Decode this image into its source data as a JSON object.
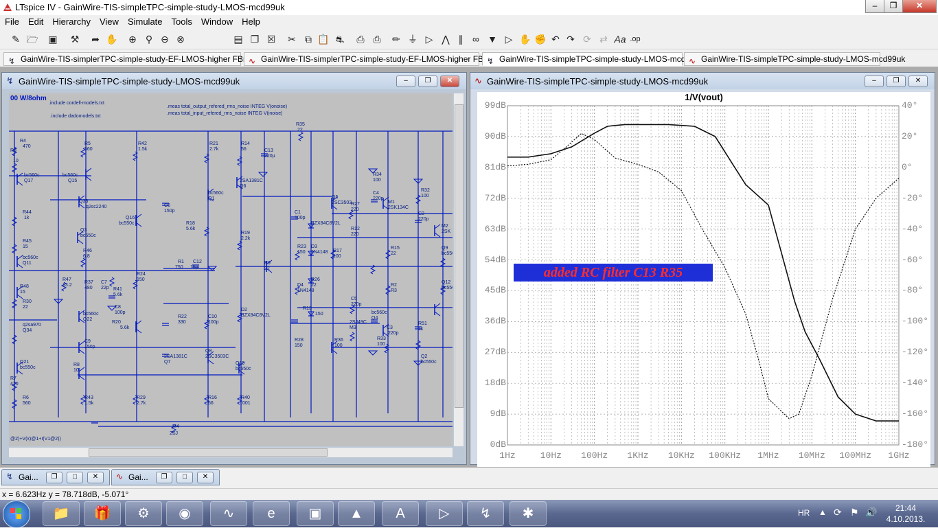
{
  "app": {
    "title": "LTspice IV - GainWire-TIS-simpleTPC-simple-study-LMOS-mcd99uk"
  },
  "menu": [
    "File",
    "Edit",
    "Hierarchy",
    "View",
    "Simulate",
    "Tools",
    "Window",
    "Help"
  ],
  "toolbar_icons": [
    "new-schematic-icon",
    "open-icon",
    "save-icon",
    "control-panel-icon",
    "run-icon",
    "halt-icon",
    "zoom-in-icon",
    "pan-icon",
    "zoom-out-icon",
    "zoom-fit-icon",
    "tile-horizontal-icon",
    "cascade-icon",
    "close-all-icon",
    "cut-icon",
    "copy-icon",
    "paste-icon",
    "find-icon",
    "print-setup-icon",
    "print-icon",
    "wire-icon",
    "ground-icon",
    "label-icon",
    "resistor-icon",
    "capacitor-icon",
    "inductor-icon",
    "diode-icon",
    "component-icon",
    "move-icon",
    "drag-icon",
    "undo-icon",
    "redo-icon",
    "rotate-icon",
    "mirror-icon",
    "text-icon",
    "spice-directive-icon"
  ],
  "tabs": [
    {
      "label": "GainWire-TIS-simplerTPC-simple-study-EF-LMOS-higher FBresistors",
      "kind": "schematic"
    },
    {
      "label": "GainWire-TIS-simplerTPC-simple-study-EF-LMOS-higher FBresistors",
      "kind": "waveform"
    },
    {
      "label": "GainWire-TIS-simpleTPC-simple-study-LMOS-mcd99uk",
      "kind": "schematic",
      "active": true
    },
    {
      "label": "GainWire-TIS-simpleTPC-simple-study-LMOS-mcd99uk",
      "kind": "waveform"
    }
  ],
  "schematic_window": {
    "title": "GainWire-TIS-simpleTPC-simple-study-LMOS-mcd99uk",
    "heading": "00 W/8ohm",
    "directives": [
      ".include cordell-models.txt",
      ".include dadomodels.txt",
      ".meas total_output_refered_rms_noise INTEG V(onoise)",
      ".meas total_input_refered_rms_noise INTEG V(inoise)"
    ],
    "labels": [
      "R4",
      "470",
      "R3",
      "10",
      "R5",
      "560",
      "R42",
      "1.5k",
      "R21",
      "2.7k",
      "R14",
      "56",
      "C13",
      "220µ",
      "R35",
      "22",
      "bc560c",
      "Q17",
      "bc560c",
      "Q15",
      "Q33",
      "q2sc2240",
      "bc560c",
      "Q1",
      "2SA1381C",
      "Q6",
      "Q5",
      "2SC3503",
      "R27",
      "220",
      "C4",
      "220p",
      "M1",
      "2SK134C",
      "R34",
      "100",
      "R32",
      "100",
      "C2",
      "220p",
      "M2",
      "2SK",
      "R44",
      "1k",
      "C6",
      "150p",
      "Q16",
      "bc550c",
      "Q3",
      "bc550c",
      "R18",
      "5.6k",
      "R19",
      "2.2k",
      "C1",
      "100p",
      "BZX84C8V2L",
      "R12",
      "220",
      "R45",
      "15",
      "R46",
      "6.8",
      "bc560c",
      "Q11",
      "R1",
      "750",
      "C12",
      ".15µ",
      "R23",
      "150",
      "D3",
      "1N4148",
      "R17",
      "100",
      "R15",
      "22",
      "Q9",
      "bc550c",
      "R9",
      "22",
      "R47",
      "13.2",
      "R37",
      "480",
      "C7",
      "22p",
      "R41",
      "5.6k",
      "R24",
      "150",
      "D4",
      "1N4148",
      "R26",
      "22",
      "R2",
      "R3",
      "Q12",
      "bc550c",
      "R48",
      "15",
      "R30",
      "22",
      "C8",
      "100p",
      "R22",
      "330",
      "D2",
      "BZX84C8V2L",
      "R13",
      "150",
      "C5",
      "220p",
      "bc560c",
      "Q4",
      "bc560c",
      "Q22",
      "R20",
      "5.6k",
      "C10",
      "100p",
      "R28",
      "150",
      "2SJ49C",
      "M3",
      "C3",
      "220p",
      "R51",
      "1k",
      "q2sa970",
      "Q34",
      "C9",
      "150p",
      "2SA1381C",
      "Q7",
      "R36",
      "100",
      "R33",
      "100",
      "Q2",
      "bc550c",
      "Q8",
      "2SC3503C",
      "Q19",
      "bc550c",
      "Q21",
      "bc550c",
      "R8",
      "10",
      "R7",
      "470",
      "R6",
      "560",
      "R43",
      "1.5k",
      "R29",
      "2.7k",
      "R16",
      "56",
      "R40",
      ".001",
      "2SJ",
      "M4"
    ],
    "expr": "@2)+V(x)@1+I(V1@2))"
  },
  "plot_window": {
    "title": "GainWire-TIS-simpleTPC-simple-study-LMOS-mcd99uk"
  },
  "annotation": "added RC filter C13 R35",
  "chart_data": {
    "type": "line",
    "title": "1/V(vout)",
    "x_ticks": [
      "1Hz",
      "10Hz",
      "100Hz",
      "1KHz",
      "10KHz",
      "100KHz",
      "1MHz",
      "10MHz",
      "100MHz",
      "1GHz"
    ],
    "y_left_ticks": [
      "99dB",
      "90dB",
      "81dB",
      "72dB",
      "63dB",
      "54dB",
      "45dB",
      "36dB",
      "27dB",
      "18dB",
      "9dB",
      "0dB"
    ],
    "y_right_ticks": [
      "40°",
      "20°",
      "0°",
      "-20°",
      "-40°",
      "-60°",
      "-80°",
      "-100°",
      "-120°",
      "-140°",
      "-160°",
      "-180°"
    ],
    "xlog": true,
    "xlim": [
      1,
      1000000000
    ],
    "ylim_left": [
      0,
      99
    ],
    "ylim_right": [
      -180,
      40
    ],
    "grid": true,
    "series": [
      {
        "style": "solid",
        "axis": "left",
        "points": [
          [
            1,
            84
          ],
          [
            3,
            84
          ],
          [
            10,
            85
          ],
          [
            30,
            87
          ],
          [
            100,
            91
          ],
          [
            200,
            93
          ],
          [
            500,
            93.5
          ],
          [
            1000,
            93.5
          ],
          [
            5000,
            93.5
          ],
          [
            20000,
            93
          ],
          [
            60000,
            90
          ],
          [
            150000,
            82
          ],
          [
            300000,
            76
          ],
          [
            1000000,
            70
          ],
          [
            2000000,
            56
          ],
          [
            4000000,
            42
          ],
          [
            7000000,
            33
          ],
          [
            15000000,
            25
          ],
          [
            40000000,
            14
          ],
          [
            100000000,
            9
          ],
          [
            300000000,
            7
          ],
          [
            1000000000,
            7
          ]
        ]
      },
      {
        "style": "dashed",
        "axis": "right",
        "points": [
          [
            1,
            1
          ],
          [
            3,
            2
          ],
          [
            10,
            5
          ],
          [
            20,
            12
          ],
          [
            50,
            22
          ],
          [
            100,
            18
          ],
          [
            300,
            6
          ],
          [
            1000,
            2
          ],
          [
            3000,
            -3
          ],
          [
            10000,
            -15
          ],
          [
            30000,
            -40
          ],
          [
            100000,
            -65
          ],
          [
            300000,
            -95
          ],
          [
            600000,
            -125
          ],
          [
            1000000,
            -150
          ],
          [
            3000000,
            -163
          ],
          [
            5000000,
            -160
          ],
          [
            10000000,
            -135
          ],
          [
            30000000,
            -85
          ],
          [
            100000000,
            -40
          ],
          [
            300000000,
            -20
          ],
          [
            1000000000,
            -7
          ]
        ]
      }
    ]
  },
  "minimized": [
    "Gai...",
    "Gai..."
  ],
  "status": {
    "cursor": "x = 6.623Hz    y = 78.718dB, -5.071°"
  },
  "taskbar": {
    "lang": "HR",
    "time": "21:44",
    "date": "4.10.2013."
  }
}
